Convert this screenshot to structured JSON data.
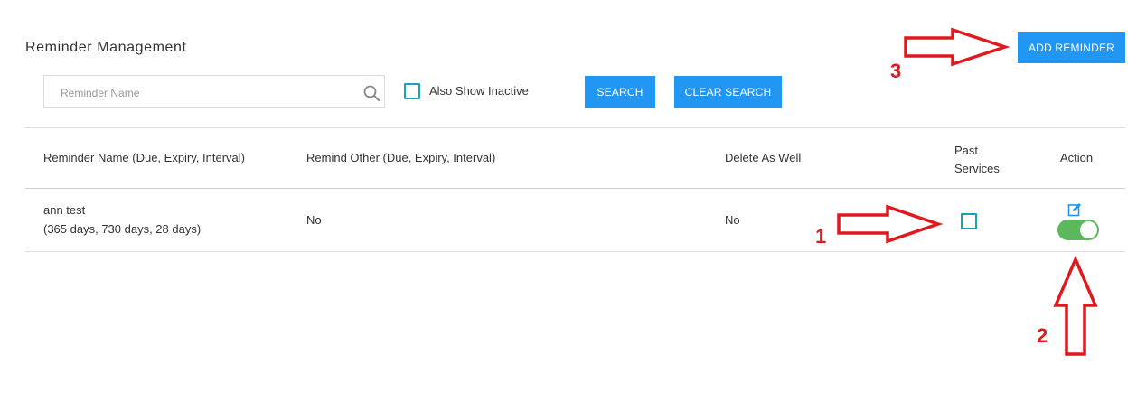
{
  "header": {
    "title": "Reminder Management",
    "add_button_label": "ADD REMINDER"
  },
  "search": {
    "placeholder": "Reminder Name",
    "value": "",
    "also_show_inactive_label": "Also Show Inactive",
    "also_show_inactive_checked": false,
    "search_button_label": "SEARCH",
    "clear_button_label": "CLEAR SEARCH"
  },
  "table": {
    "columns": [
      "Reminder Name (Due, Expiry, Interval)",
      "Remind Other (Due, Expiry, Interval)",
      "Delete As Well",
      "Past Services",
      "Action"
    ],
    "rows": [
      {
        "name": "ann test",
        "details": "(365 days, 730 days, 28 days)",
        "remind_other": "No",
        "delete_as_well": "No",
        "past_services_checked": false,
        "active": true
      }
    ]
  },
  "annotations": {
    "labels": [
      "1",
      "2",
      "3"
    ],
    "color": "#e0191f"
  },
  "colors": {
    "primary_button": "#2196f3",
    "checkbox_border": "#17a2b8",
    "toggle_on": "#5cb85c",
    "edit_icon": "#2196f3"
  }
}
